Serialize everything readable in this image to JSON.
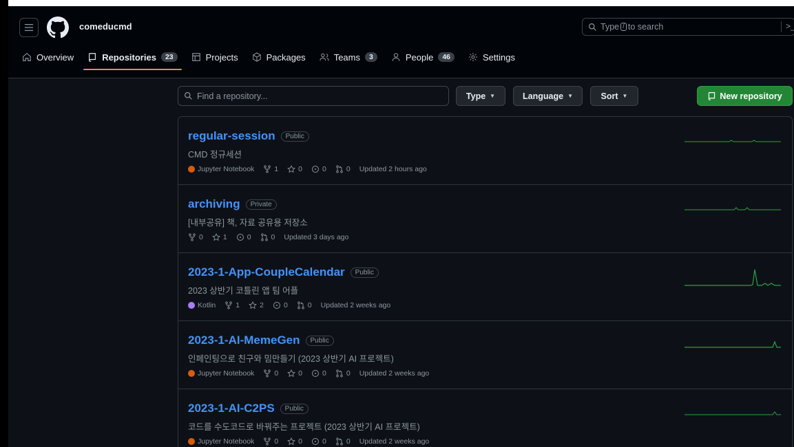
{
  "header": {
    "org_name": "comeducmd",
    "search_prefix": "Type",
    "search_key": "/",
    "search_suffix": "to search",
    "command_glyph": ">_"
  },
  "nav": {
    "items": [
      {
        "label": "Overview",
        "icon": "home-icon"
      },
      {
        "label": "Repositories",
        "icon": "repo-icon",
        "count": "23",
        "active": true
      },
      {
        "label": "Projects",
        "icon": "table-icon"
      },
      {
        "label": "Packages",
        "icon": "package-icon"
      },
      {
        "label": "Teams",
        "icon": "people-icon",
        "count": "3"
      },
      {
        "label": "People",
        "icon": "person-icon",
        "count": "46"
      },
      {
        "label": "Settings",
        "icon": "gear-icon"
      }
    ]
  },
  "filters": {
    "find_placeholder": "Find a repository...",
    "type_label": "Type",
    "language_label": "Language",
    "sort_label": "Sort",
    "new_repo_label": "New repository"
  },
  "colors": {
    "accent_link": "#4493f8",
    "jupyter": "#DA5B0B",
    "kotlin": "#A97BFF",
    "spark": "#2ea043",
    "new_button": "#238636",
    "tab_underline": "#f78166"
  },
  "repos": [
    {
      "name": "regular-session",
      "visibility": "Public",
      "description": "CMD 정규세션",
      "language": "Jupyter Notebook",
      "lang_color": "#DA5B0B",
      "forks": "1",
      "stars": "0",
      "issues": "0",
      "prs": "0",
      "updated": "Updated 2 hours ago"
    },
    {
      "name": "archiving",
      "visibility": "Private",
      "description": "[내부공유] 책, 자료 공유용 저장소",
      "language": "",
      "lang_color": "",
      "forks": "0",
      "stars": "1",
      "issues": "0",
      "prs": "0",
      "updated": "Updated 3 days ago"
    },
    {
      "name": "2023-1-App-CoupleCalendar",
      "visibility": "Public",
      "description": "2023 상반기 코틀린 앱 팀 어플",
      "language": "Kotlin",
      "lang_color": "#A97BFF",
      "forks": "1",
      "stars": "2",
      "issues": "0",
      "prs": "0",
      "updated": "Updated 2 weeks ago"
    },
    {
      "name": "2023-1-AI-MemeGen",
      "visibility": "Public",
      "description": "인페인팅으로 친구와 밈만들기 (2023 상반기 AI 프로젝트)",
      "language": "Jupyter Notebook",
      "lang_color": "#DA5B0B",
      "forks": "0",
      "stars": "0",
      "issues": "0",
      "prs": "0",
      "updated": "Updated 2 weeks ago"
    },
    {
      "name": "2023-1-AI-C2PS",
      "visibility": "Public",
      "description": "코드를 수도코드로 바꿔주는 프로젝트 (2023 상반기 AI 프로젝트)",
      "language": "Jupyter Notebook",
      "lang_color": "#DA5B0B",
      "forks": "0",
      "stars": "0",
      "issues": "0",
      "prs": "0",
      "updated": "Updated 2 weeks ago"
    }
  ]
}
